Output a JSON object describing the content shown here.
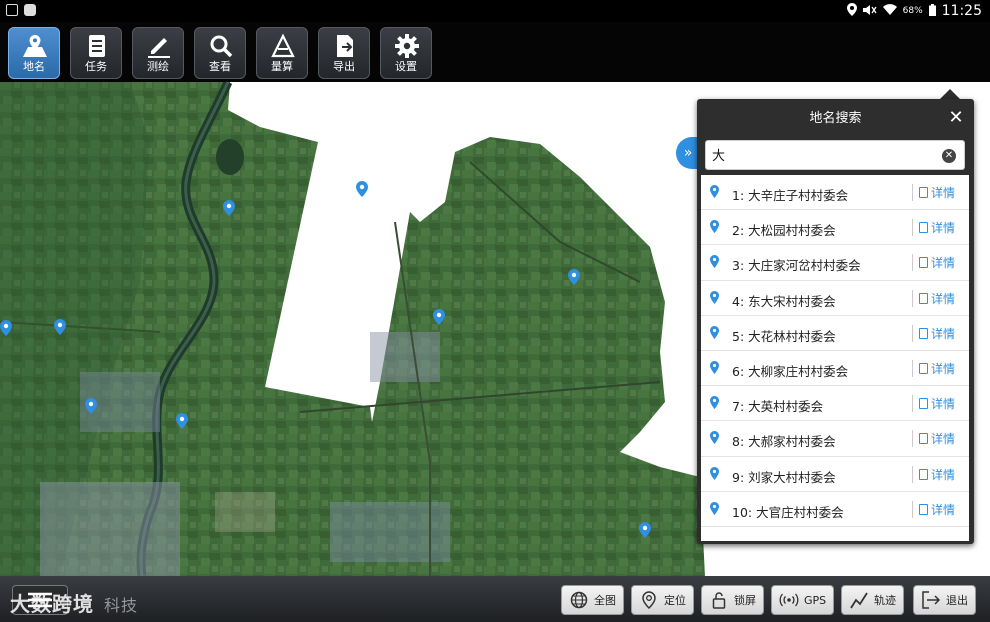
{
  "status_bar": {
    "battery": "68%",
    "time": "11:25"
  },
  "toolbar": {
    "items": [
      {
        "label": "地名",
        "icon": "place-name-icon"
      },
      {
        "label": "任务",
        "icon": "task-list-icon"
      },
      {
        "label": "测绘",
        "icon": "pencil-icon"
      },
      {
        "label": "查看",
        "icon": "search-icon"
      },
      {
        "label": "量算",
        "icon": "measure-icon"
      },
      {
        "label": "导出",
        "icon": "export-icon"
      },
      {
        "label": "设置",
        "icon": "gear-icon"
      }
    ],
    "active_index": 0
  },
  "search_panel": {
    "title": "地名搜索",
    "query": "大",
    "detail_label": "详情",
    "results": [
      "1: 大辛庄子村村委会",
      "2: 大松园村村委会",
      "3: 大庄家河岔村村委会",
      "4: 东大宋村村委会",
      "5: 大花林村村委会",
      "6: 大柳家庄村村委会",
      "7: 大英村村委会",
      "8: 大郝家村村委会",
      "9: 刘家大村村委会",
      "10: 大官庄村村委会"
    ]
  },
  "bottom_bar": {
    "buttons": [
      {
        "label": "全图",
        "icon": "globe-icon"
      },
      {
        "label": "定位",
        "icon": "location-pin-icon"
      },
      {
        "label": "锁屏",
        "icon": "lock-icon"
      },
      {
        "label": "GPS",
        "icon": "gps-signal-icon"
      },
      {
        "label": "轨迹",
        "icon": "track-icon"
      },
      {
        "label": "退出",
        "icon": "exit-icon"
      }
    ]
  },
  "watermark": {
    "main": "大数跨境",
    "tail": "科技"
  },
  "colors": {
    "accent": "#2f8fe0",
    "panel_bg": "#2e2e2e",
    "map_green": "#3f6b3a"
  }
}
